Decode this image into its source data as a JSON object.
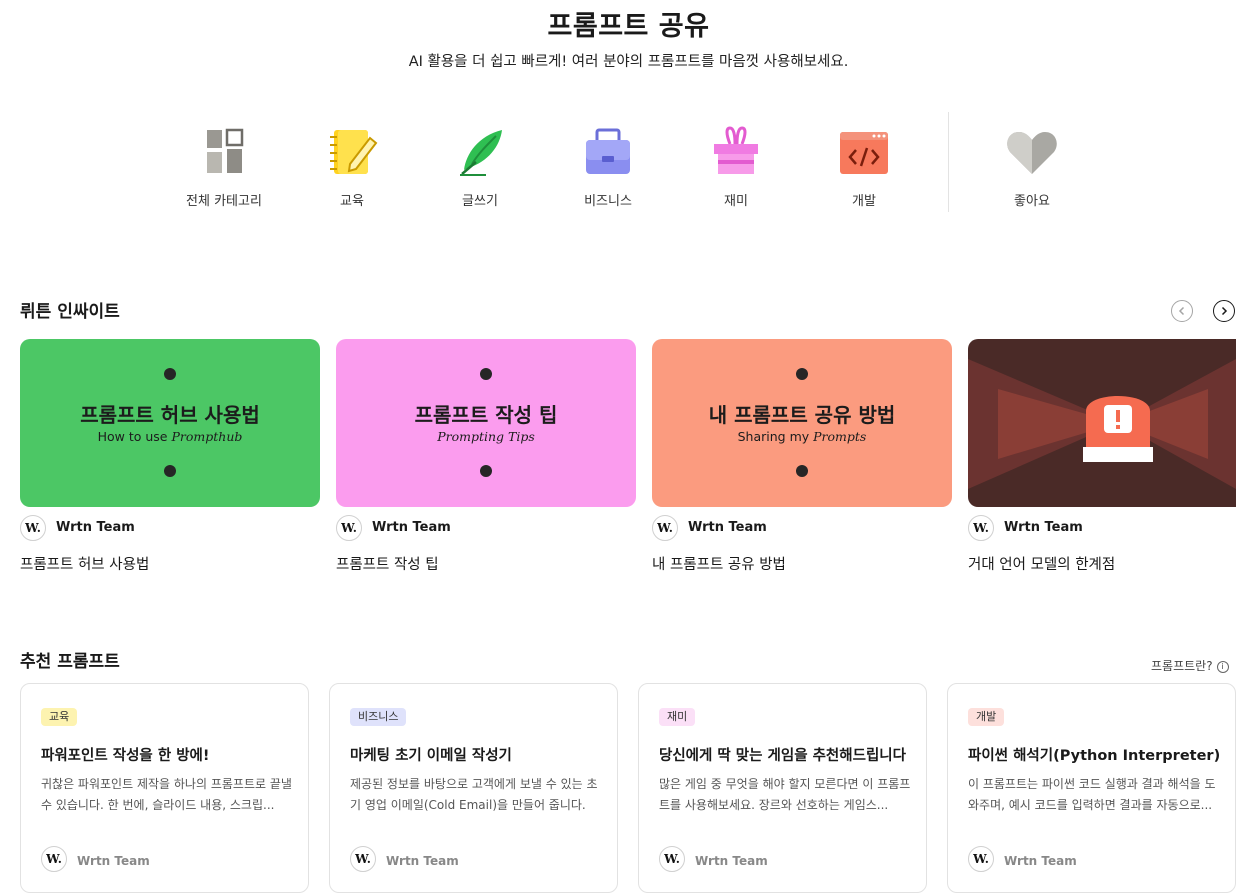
{
  "header": {
    "title": "프롬프트 공유",
    "subtitle": "AI 활용을 더 쉽고 빠르게! 여러 분야의 프롬프트를 마음껏 사용해보세요."
  },
  "categories": [
    {
      "label": "전체 카테고리",
      "icon": "grid-icon"
    },
    {
      "label": "교육",
      "icon": "notebook-pencil-icon"
    },
    {
      "label": "글쓰기",
      "icon": "quill-feather-icon"
    },
    {
      "label": "비즈니스",
      "icon": "briefcase-icon"
    },
    {
      "label": "재미",
      "icon": "gift-box-icon"
    },
    {
      "label": "개발",
      "icon": "code-window-icon"
    },
    {
      "label": "좋아요",
      "icon": "heart-icon"
    }
  ],
  "insights": {
    "title": "뤼튼 인싸이트",
    "cards": [
      {
        "thumb_kr": "프롬프트 허브 사용법",
        "thumb_en_plain": "How to use ",
        "thumb_en_italic": "Prompthub",
        "author": "Wrtn Team",
        "title": "프롬프트 허브 사용법",
        "color": "#4cc765"
      },
      {
        "thumb_kr": "프롬프트 작성 팁",
        "thumb_en_plain": "",
        "thumb_en_italic": "Prompting Tips",
        "author": "Wrtn Team",
        "title": "프롬프트 작성 팁",
        "color": "#fb9cee"
      },
      {
        "thumb_kr": "내 프롬프트 공유 방법",
        "thumb_en_plain": "Sharing my ",
        "thumb_en_italic": "Prompts",
        "author": "Wrtn Team",
        "title": "내 프롬프트 공유 방법",
        "color": "#fb9b7f"
      },
      {
        "author": "Wrtn Team",
        "title": "거대 언어 모델의 한계점",
        "color": "#4a2a27"
      }
    ]
  },
  "recommended": {
    "title": "추천 프롬프트",
    "whatis": "프롬프트란?",
    "cards": [
      {
        "badge": "교육",
        "badge_color": "#fdf3b0",
        "title": "파워포인트 작성을 한 방에!",
        "desc": "귀찮은 파워포인트 제작을 하나의 프롬프트로 끝낼 수 있습니다. 한 번에, 슬라이드 내용, 스크립...",
        "author": "Wrtn Team"
      },
      {
        "badge": "비즈니스",
        "badge_color": "#dfe2fb",
        "title": "마케팅 초기 이메일 작성기",
        "desc": "제공된 정보를 바탕으로 고객에게 보낼 수 있는 초기 영업 이메일(Cold Email)을 만들어 줍니다.",
        "author": "Wrtn Team"
      },
      {
        "badge": "재미",
        "badge_color": "#fbe0f7",
        "title": "당신에게 딱 맞는 게임을 추천해드립니다",
        "desc": "많은 게임 중 무엇을 해야 할지 모른다면 이 프롬프트를 사용해보세요. 장르와 선호하는 게임스...",
        "author": "Wrtn Team"
      },
      {
        "badge": "개발",
        "badge_color": "#fde0dc",
        "title": "파이썬 해석기(Python Interpreter)",
        "desc": "이 프롬프트는 파이썬 코드 실행과 결과 해석을 도와주며, 예시 코드를 입력하면 결과를 자동으로...",
        "author": "Wrtn Team"
      }
    ]
  },
  "logo_text": "W."
}
